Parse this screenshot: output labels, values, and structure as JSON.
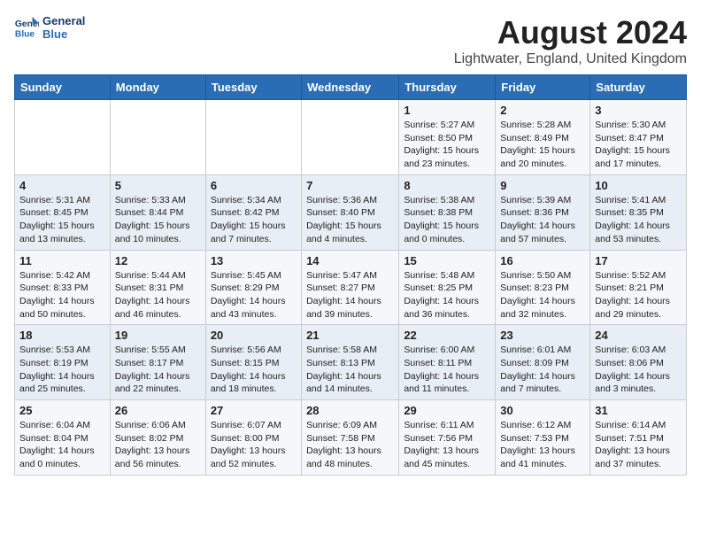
{
  "logo": {
    "line1": "General",
    "line2": "Blue"
  },
  "title": "August 2024",
  "subtitle": "Lightwater, England, United Kingdom",
  "weekdays": [
    "Sunday",
    "Monday",
    "Tuesday",
    "Wednesday",
    "Thursday",
    "Friday",
    "Saturday"
  ],
  "weeks": [
    [
      {
        "day": "",
        "info": ""
      },
      {
        "day": "",
        "info": ""
      },
      {
        "day": "",
        "info": ""
      },
      {
        "day": "",
        "info": ""
      },
      {
        "day": "1",
        "info": "Sunrise: 5:27 AM\nSunset: 8:50 PM\nDaylight: 15 hours\nand 23 minutes."
      },
      {
        "day": "2",
        "info": "Sunrise: 5:28 AM\nSunset: 8:49 PM\nDaylight: 15 hours\nand 20 minutes."
      },
      {
        "day": "3",
        "info": "Sunrise: 5:30 AM\nSunset: 8:47 PM\nDaylight: 15 hours\nand 17 minutes."
      }
    ],
    [
      {
        "day": "4",
        "info": "Sunrise: 5:31 AM\nSunset: 8:45 PM\nDaylight: 15 hours\nand 13 minutes."
      },
      {
        "day": "5",
        "info": "Sunrise: 5:33 AM\nSunset: 8:44 PM\nDaylight: 15 hours\nand 10 minutes."
      },
      {
        "day": "6",
        "info": "Sunrise: 5:34 AM\nSunset: 8:42 PM\nDaylight: 15 hours\nand 7 minutes."
      },
      {
        "day": "7",
        "info": "Sunrise: 5:36 AM\nSunset: 8:40 PM\nDaylight: 15 hours\nand 4 minutes."
      },
      {
        "day": "8",
        "info": "Sunrise: 5:38 AM\nSunset: 8:38 PM\nDaylight: 15 hours\nand 0 minutes."
      },
      {
        "day": "9",
        "info": "Sunrise: 5:39 AM\nSunset: 8:36 PM\nDaylight: 14 hours\nand 57 minutes."
      },
      {
        "day": "10",
        "info": "Sunrise: 5:41 AM\nSunset: 8:35 PM\nDaylight: 14 hours\nand 53 minutes."
      }
    ],
    [
      {
        "day": "11",
        "info": "Sunrise: 5:42 AM\nSunset: 8:33 PM\nDaylight: 14 hours\nand 50 minutes."
      },
      {
        "day": "12",
        "info": "Sunrise: 5:44 AM\nSunset: 8:31 PM\nDaylight: 14 hours\nand 46 minutes."
      },
      {
        "day": "13",
        "info": "Sunrise: 5:45 AM\nSunset: 8:29 PM\nDaylight: 14 hours\nand 43 minutes."
      },
      {
        "day": "14",
        "info": "Sunrise: 5:47 AM\nSunset: 8:27 PM\nDaylight: 14 hours\nand 39 minutes."
      },
      {
        "day": "15",
        "info": "Sunrise: 5:48 AM\nSunset: 8:25 PM\nDaylight: 14 hours\nand 36 minutes."
      },
      {
        "day": "16",
        "info": "Sunrise: 5:50 AM\nSunset: 8:23 PM\nDaylight: 14 hours\nand 32 minutes."
      },
      {
        "day": "17",
        "info": "Sunrise: 5:52 AM\nSunset: 8:21 PM\nDaylight: 14 hours\nand 29 minutes."
      }
    ],
    [
      {
        "day": "18",
        "info": "Sunrise: 5:53 AM\nSunset: 8:19 PM\nDaylight: 14 hours\nand 25 minutes."
      },
      {
        "day": "19",
        "info": "Sunrise: 5:55 AM\nSunset: 8:17 PM\nDaylight: 14 hours\nand 22 minutes."
      },
      {
        "day": "20",
        "info": "Sunrise: 5:56 AM\nSunset: 8:15 PM\nDaylight: 14 hours\nand 18 minutes."
      },
      {
        "day": "21",
        "info": "Sunrise: 5:58 AM\nSunset: 8:13 PM\nDaylight: 14 hours\nand 14 minutes."
      },
      {
        "day": "22",
        "info": "Sunrise: 6:00 AM\nSunset: 8:11 PM\nDaylight: 14 hours\nand 11 minutes."
      },
      {
        "day": "23",
        "info": "Sunrise: 6:01 AM\nSunset: 8:09 PM\nDaylight: 14 hours\nand 7 minutes."
      },
      {
        "day": "24",
        "info": "Sunrise: 6:03 AM\nSunset: 8:06 PM\nDaylight: 14 hours\nand 3 minutes."
      }
    ],
    [
      {
        "day": "25",
        "info": "Sunrise: 6:04 AM\nSunset: 8:04 PM\nDaylight: 14 hours\nand 0 minutes."
      },
      {
        "day": "26",
        "info": "Sunrise: 6:06 AM\nSunset: 8:02 PM\nDaylight: 13 hours\nand 56 minutes."
      },
      {
        "day": "27",
        "info": "Sunrise: 6:07 AM\nSunset: 8:00 PM\nDaylight: 13 hours\nand 52 minutes."
      },
      {
        "day": "28",
        "info": "Sunrise: 6:09 AM\nSunset: 7:58 PM\nDaylight: 13 hours\nand 48 minutes."
      },
      {
        "day": "29",
        "info": "Sunrise: 6:11 AM\nSunset: 7:56 PM\nDaylight: 13 hours\nand 45 minutes."
      },
      {
        "day": "30",
        "info": "Sunrise: 6:12 AM\nSunset: 7:53 PM\nDaylight: 13 hours\nand 41 minutes."
      },
      {
        "day": "31",
        "info": "Sunrise: 6:14 AM\nSunset: 7:51 PM\nDaylight: 13 hours\nand 37 minutes."
      }
    ]
  ]
}
